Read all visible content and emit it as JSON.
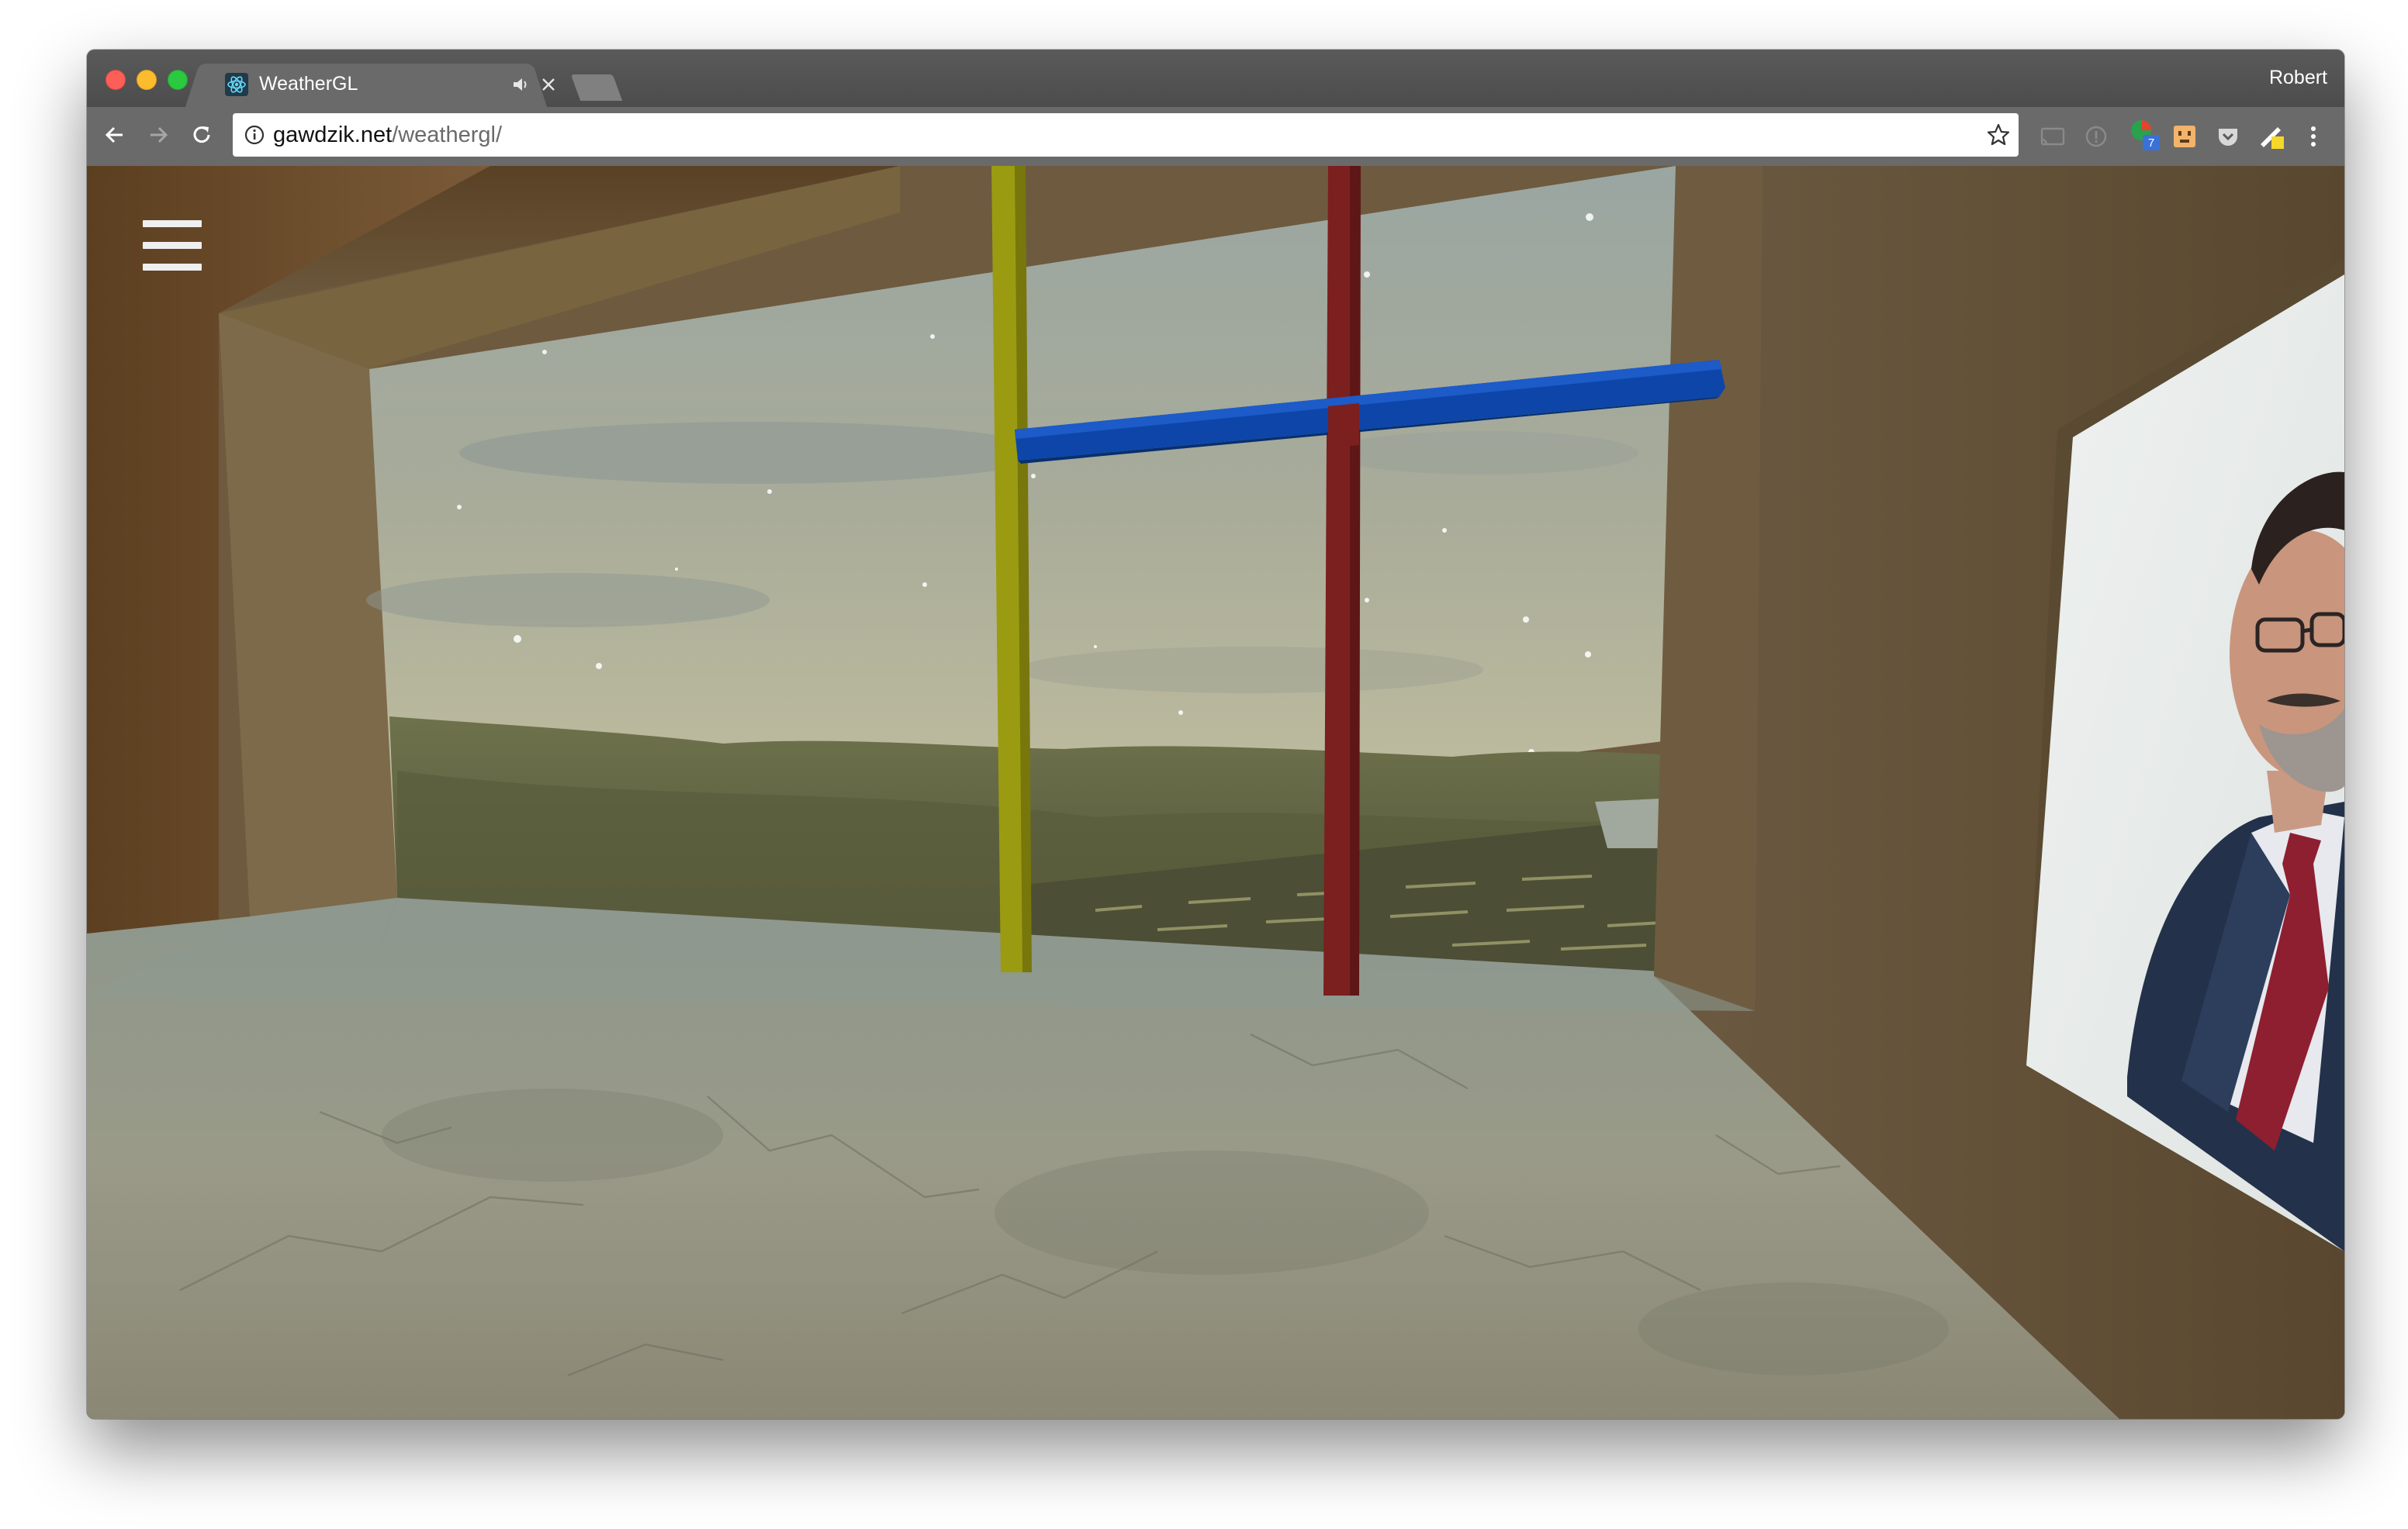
{
  "browser": {
    "tab": {
      "title": "WeatherGL",
      "favicon": "react-atom-icon",
      "audio_icon": "speaker-icon",
      "close_icon": "close-icon"
    },
    "profile_name": "Robert",
    "address_bar": {
      "host": "gawdzik.net",
      "path": "/weathergl/",
      "security_icon": "info-icon",
      "bookmark_icon": "star-icon"
    },
    "extensions": [
      "cast-icon",
      "circle-info-extension-icon",
      "chrome-extension-badge-icon",
      "face-extension-icon",
      "pocket-icon",
      "note-extension-icon",
      "more-menu-icon"
    ],
    "extension_badge": "7"
  },
  "app": {
    "menu_icon": "hamburger-menu-icon"
  },
  "colors": {
    "pole_yellow": "#9a9a10",
    "pole_red": "#7a1e1e",
    "beam_blue": "#0d46a8",
    "wall": "#7a6447",
    "floor": "#8e8e80"
  }
}
